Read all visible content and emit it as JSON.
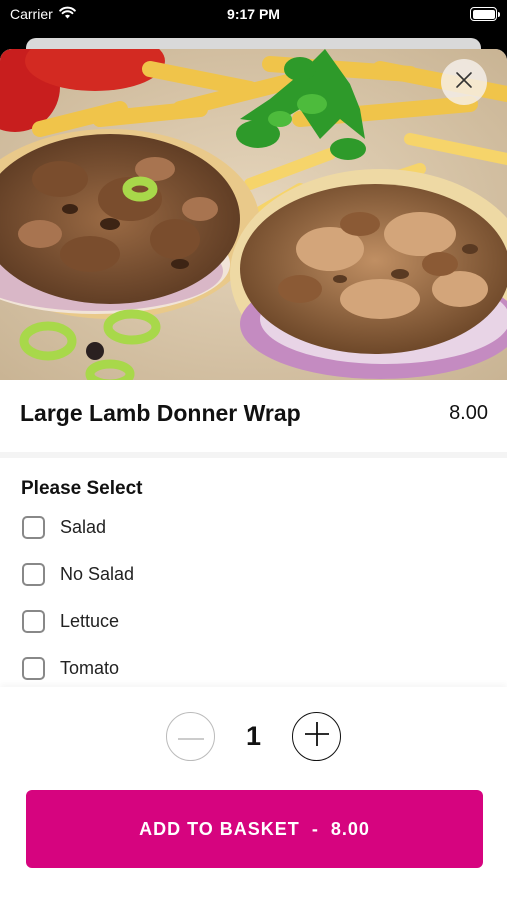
{
  "status_bar": {
    "carrier": "Carrier",
    "time": "9:17 PM"
  },
  "product": {
    "name": "Large Lamb Donner Wrap",
    "price": "8.00"
  },
  "options": {
    "title": "Please Select",
    "items": [
      {
        "label": "Salad",
        "checked": false
      },
      {
        "label": "No Salad",
        "checked": false
      },
      {
        "label": "Lettuce",
        "checked": false
      },
      {
        "label": "Tomato",
        "checked": false
      }
    ]
  },
  "quantity": {
    "value": "1"
  },
  "add_button": {
    "label": "ADD TO BASKET",
    "separator": "-",
    "price": "8.00"
  },
  "icons": {
    "close": "close-icon",
    "minus": "minus-icon",
    "plus": "plus-icon",
    "wifi": "wifi-icon",
    "battery": "battery-icon"
  },
  "colors": {
    "accent": "#d6047f"
  }
}
